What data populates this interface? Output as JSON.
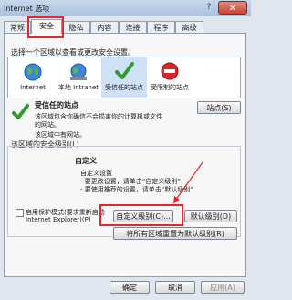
{
  "window": {
    "title": "Internet 选项",
    "help": "?",
    "close": "✕"
  },
  "tabs": [
    {
      "label": "常规"
    },
    {
      "label": "安全"
    },
    {
      "label": "隐私"
    },
    {
      "label": "内容"
    },
    {
      "label": "连接"
    },
    {
      "label": "程序"
    },
    {
      "label": "高级"
    }
  ],
  "zones": {
    "prompt": "选择一个区域以查看或更改安全设置。",
    "items": [
      {
        "label": "Internet",
        "icon": "globe-icon"
      },
      {
        "label": "本地 Intranet",
        "icon": "intranet-globe-icon"
      },
      {
        "label": "受信任的站点",
        "icon": "green-check-icon"
      },
      {
        "label": "受限制的站点",
        "icon": "no-entry-icon"
      }
    ]
  },
  "selected_zone": {
    "name": "受信任的站点",
    "desc1": "该区域包含你确信不会损害你的计算机或文件",
    "desc2": "的网站。",
    "desc3": "该区域中有网站。",
    "sites_button": "站点(S)"
  },
  "security_level": {
    "group_label": "该区域的安全级别(L)",
    "custom_title": "自定义",
    "custom_line1": "自定义设置",
    "custom_line2": "- 要更改设置，请单击“自定义级别”",
    "custom_line3": "- 要使用推荐的设置，请单击“默认级别”"
  },
  "protected_mode": {
    "label": "启用保护模式(要求重新启动",
    "label2": "Internet Explorer)(P)",
    "checked": false
  },
  "buttons": {
    "custom_level": "自定义级别(C)...",
    "default_level": "默认级别(D)",
    "reset_all": "将所有区域重置为默认级别(R)",
    "ok": "确定",
    "cancel": "取消",
    "apply": "应用(A)"
  },
  "colors": {
    "highlight": "#e0282e",
    "accent": "#cfe1f6"
  }
}
